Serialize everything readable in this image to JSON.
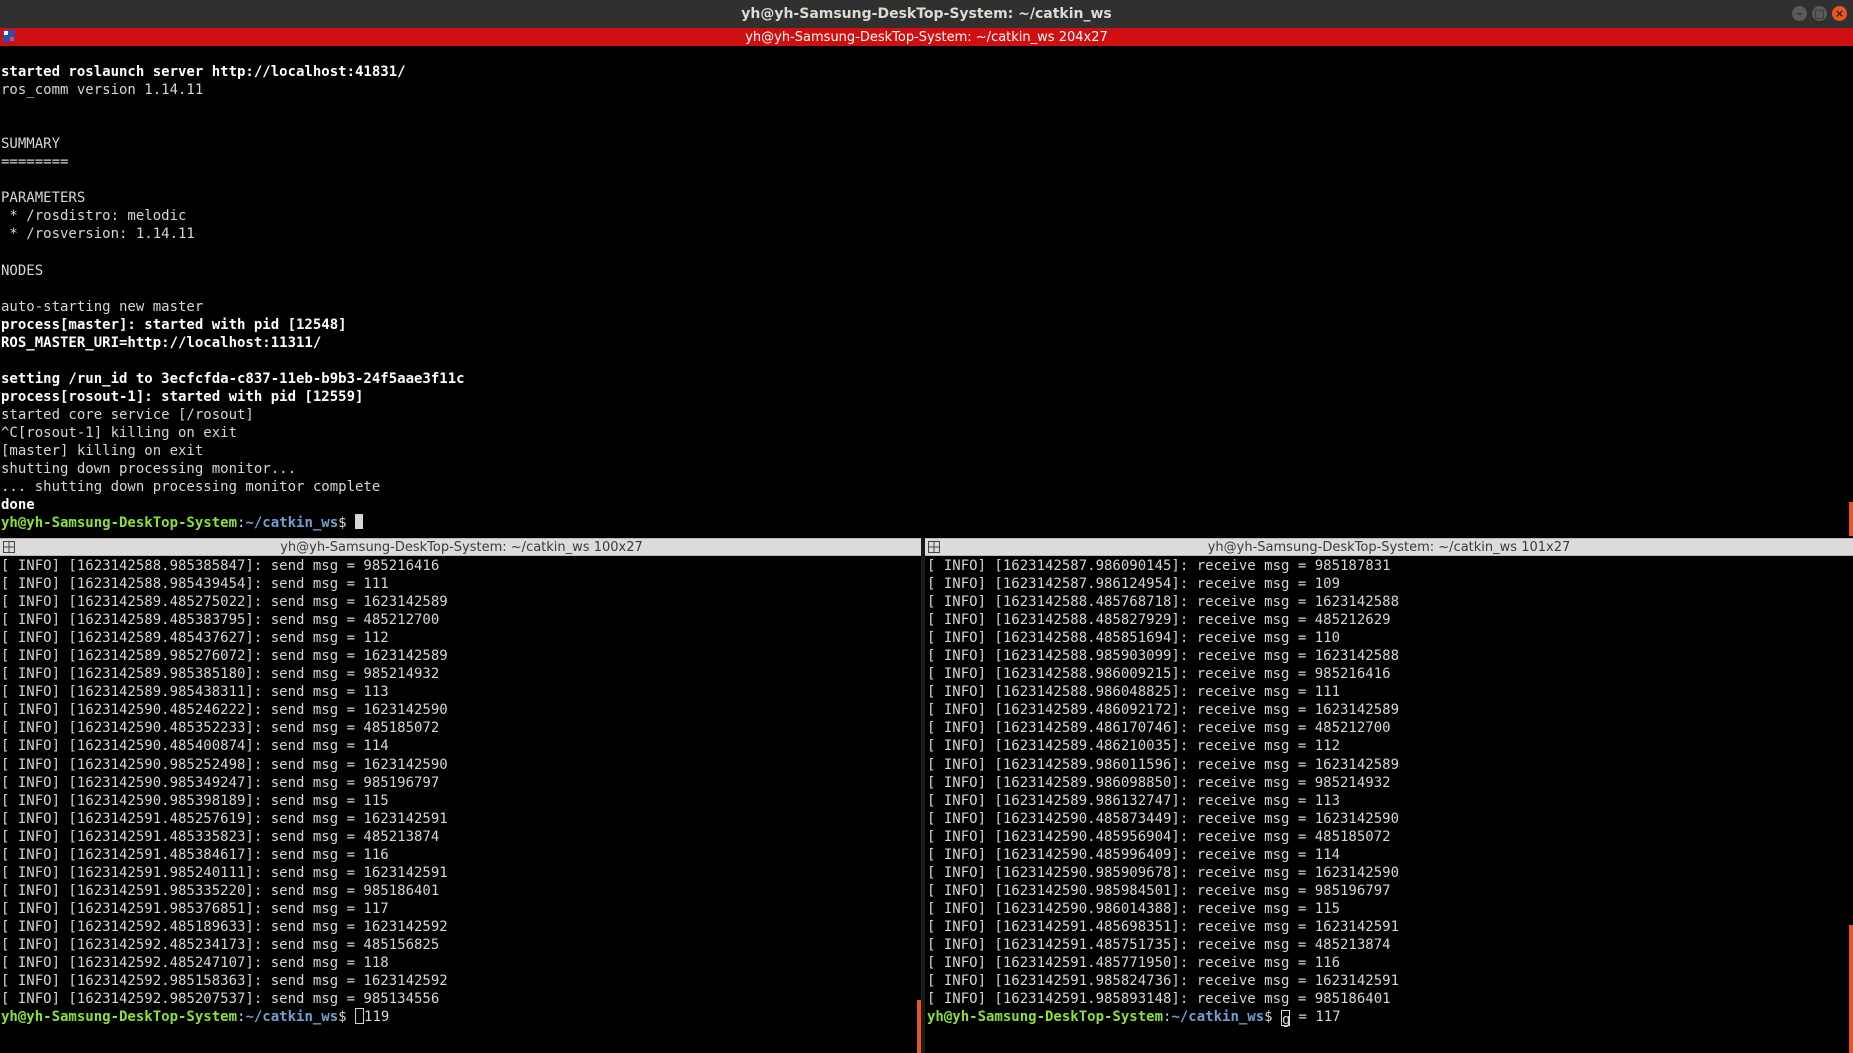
{
  "window": {
    "title": "yh@yh-Samsung-DeskTop-System: ~/catkin_ws"
  },
  "top_pane": {
    "title": "yh@yh-Samsung-DeskTop-System: ~/catkin_ws 204x27",
    "lines": [
      {
        "t": "started roslaunch server http://localhost:41831/",
        "b": true
      },
      {
        "t": "ros_comm version 1.14.11"
      },
      {
        "t": ""
      },
      {
        "t": ""
      },
      {
        "t": "SUMMARY"
      },
      {
        "t": "========"
      },
      {
        "t": ""
      },
      {
        "t": "PARAMETERS"
      },
      {
        "t": " * /rosdistro: melodic"
      },
      {
        "t": " * /rosversion: 1.14.11"
      },
      {
        "t": ""
      },
      {
        "t": "NODES"
      },
      {
        "t": ""
      },
      {
        "t": "auto-starting new master"
      },
      {
        "t": "process[master]: started with pid [12548]",
        "b": true
      },
      {
        "t": "ROS_MASTER_URI=http://localhost:11311/",
        "b": true
      },
      {
        "t": ""
      },
      {
        "t": "setting /run_id to 3ecfcfda-c837-11eb-b9b3-24f5aae3f11c",
        "b": true
      },
      {
        "t": "process[rosout-1]: started with pid [12559]",
        "b": true
      },
      {
        "t": "started core service [/rosout]"
      },
      {
        "t": "^C[rosout-1] killing on exit"
      },
      {
        "t": "[master] killing on exit"
      },
      {
        "t": "shutting down processing monitor..."
      },
      {
        "t": "... shutting down processing monitor complete"
      },
      {
        "t": "done",
        "b": true
      }
    ],
    "prompt": {
      "user": "yh@yh-Samsung-DeskTop-System",
      "sep": ":",
      "path": "~/catkin_ws",
      "symbol": "$ ",
      "input": ""
    }
  },
  "left_pane": {
    "title": "yh@yh-Samsung-DeskTop-System: ~/catkin_ws 100x27",
    "lines": [
      "[ INFO] [1623142588.985385847]: send msg = 985216416",
      "[ INFO] [1623142588.985439454]: send msg = 111",
      "[ INFO] [1623142589.485275022]: send msg = 1623142589",
      "[ INFO] [1623142589.485383795]: send msg = 485212700",
      "[ INFO] [1623142589.485437627]: send msg = 112",
      "[ INFO] [1623142589.985276072]: send msg = 1623142589",
      "[ INFO] [1623142589.985385180]: send msg = 985214932",
      "[ INFO] [1623142589.985438311]: send msg = 113",
      "[ INFO] [1623142590.485246222]: send msg = 1623142590",
      "[ INFO] [1623142590.485352233]: send msg = 485185072",
      "[ INFO] [1623142590.485400874]: send msg = 114",
      "[ INFO] [1623142590.985252498]: send msg = 1623142590",
      "[ INFO] [1623142590.985349247]: send msg = 985196797",
      "[ INFO] [1623142590.985398189]: send msg = 115",
      "[ INFO] [1623142591.485257619]: send msg = 1623142591",
      "[ INFO] [1623142591.485335823]: send msg = 485213874",
      "[ INFO] [1623142591.485384617]: send msg = 116",
      "[ INFO] [1623142591.985240111]: send msg = 1623142591",
      "[ INFO] [1623142591.985335220]: send msg = 985186401",
      "[ INFO] [1623142591.985376851]: send msg = 117",
      "[ INFO] [1623142592.485189633]: send msg = 1623142592",
      "[ INFO] [1623142592.485234173]: send msg = 485156825",
      "[ INFO] [1623142592.485247107]: send msg = 118",
      "[ INFO] [1623142592.985158363]: send msg = 1623142592",
      "[ INFO] [1623142592.985207537]: send msg = 985134556"
    ],
    "prompt": {
      "user": "yh@yh-Samsung-DeskTop-System",
      "sep": ":",
      "path": "~/catkin_ws",
      "symbol": "$ ",
      "input": "119"
    }
  },
  "right_pane": {
    "title": "yh@yh-Samsung-DeskTop-System: ~/catkin_ws 101x27",
    "lines": [
      "[ INFO] [1623142587.986090145]: receive msg = 985187831",
      "[ INFO] [1623142587.986124954]: receive msg = 109",
      "[ INFO] [1623142588.485768718]: receive msg = 1623142588",
      "[ INFO] [1623142588.485827929]: receive msg = 485212629",
      "[ INFO] [1623142588.485851694]: receive msg = 110",
      "[ INFO] [1623142588.985903099]: receive msg = 1623142588",
      "[ INFO] [1623142588.986009215]: receive msg = 985216416",
      "[ INFO] [1623142588.986048825]: receive msg = 111",
      "[ INFO] [1623142589.486092172]: receive msg = 1623142589",
      "[ INFO] [1623142589.486170746]: receive msg = 485212700",
      "[ INFO] [1623142589.486210035]: receive msg = 112",
      "[ INFO] [1623142589.986011596]: receive msg = 1623142589",
      "[ INFO] [1623142589.986098850]: receive msg = 985214932",
      "[ INFO] [1623142589.986132747]: receive msg = 113",
      "[ INFO] [1623142590.485873449]: receive msg = 1623142590",
      "[ INFO] [1623142590.485956904]: receive msg = 485185072",
      "[ INFO] [1623142590.485996409]: receive msg = 114",
      "[ INFO] [1623142590.985909678]: receive msg = 1623142590",
      "[ INFO] [1623142590.985984501]: receive msg = 985196797",
      "[ INFO] [1623142590.986014388]: receive msg = 115",
      "[ INFO] [1623142591.485698351]: receive msg = 1623142591",
      "[ INFO] [1623142591.485751735]: receive msg = 485213874",
      "[ INFO] [1623142591.485771950]: receive msg = 116",
      "[ INFO] [1623142591.985824736]: receive msg = 1623142591",
      "[ INFO] [1623142591.985893148]: receive msg = 985186401"
    ],
    "prompt": {
      "user": "yh@yh-Samsung-DeskTop-System",
      "sep": ":",
      "path": "~/catkin_ws",
      "symbol": "$ ",
      "cursor_char": "g",
      "input": " = 117"
    }
  },
  "colors": {
    "active_titlebar": "#d01010",
    "prompt_user": "#8ae234",
    "prompt_path": "#729fcf",
    "scrollbar_accent": "#e95420"
  }
}
